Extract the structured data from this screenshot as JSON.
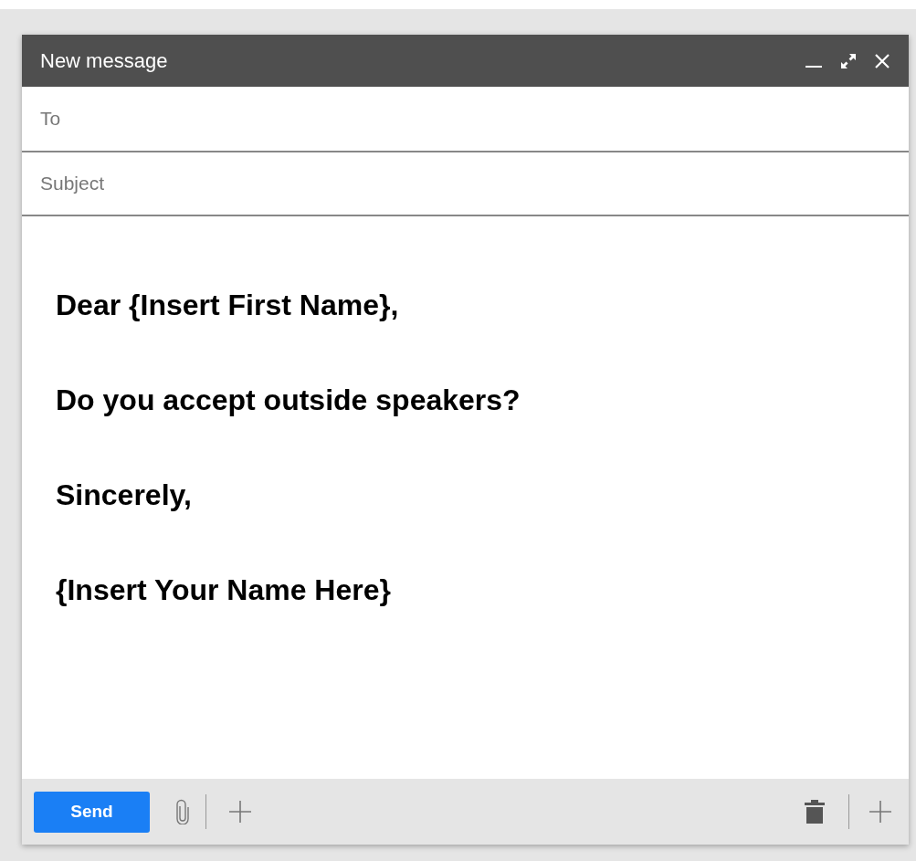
{
  "window": {
    "title": "New message"
  },
  "fields": [
    {
      "placeholder": "To"
    },
    {
      "placeholder": "Subject"
    }
  ],
  "body": [
    "Dear {Insert First Name},",
    "Do you accept outside speakers?",
    "Sincerely,",
    "{Insert Your Name Here}"
  ],
  "footer": {
    "send": "Send"
  }
}
